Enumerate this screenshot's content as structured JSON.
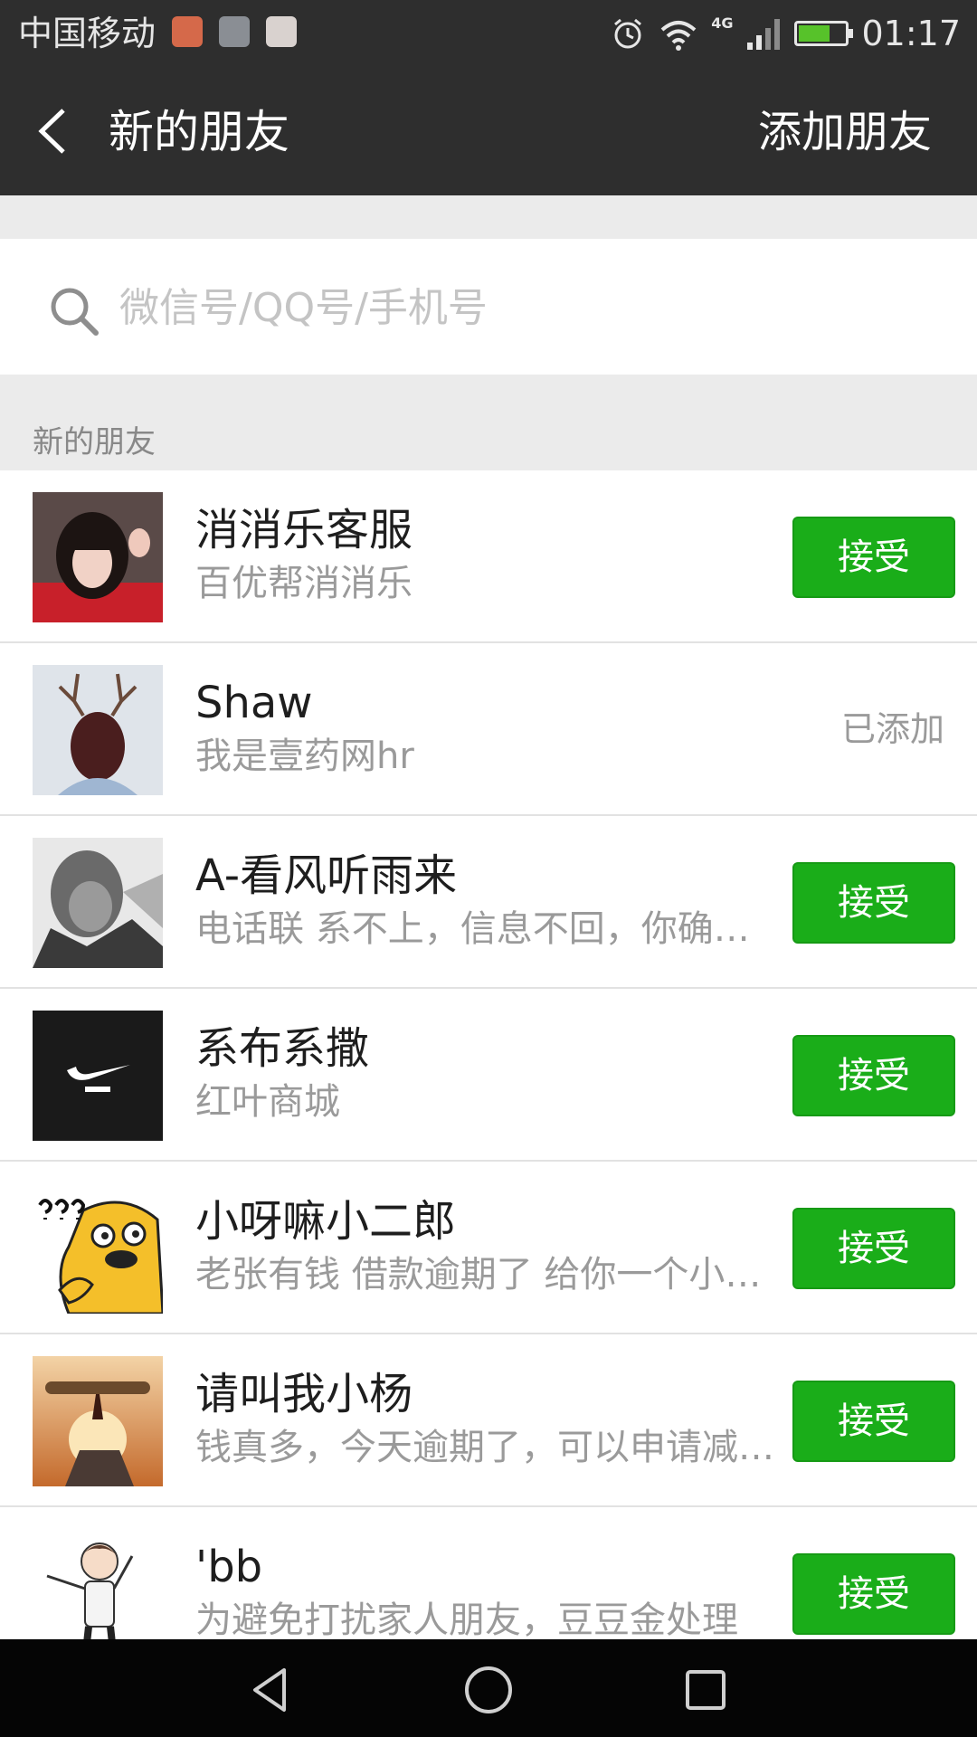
{
  "status_bar": {
    "carrier": "中国移动",
    "network": "4G",
    "time": "01:17",
    "icons_left": [
      "mail-notification-icon",
      "gallery-notification-icon",
      "photo-notification-icon"
    ],
    "icons_right": [
      "alarm-icon",
      "wifi-icon",
      "signal-icon",
      "battery-icon"
    ],
    "battery_level": 0.7,
    "battery_charging": true
  },
  "header": {
    "title": "新的朋友",
    "action_label": "添加朋友"
  },
  "search": {
    "placeholder": "微信号/QQ号/手机号"
  },
  "section": {
    "title": "新的朋友"
  },
  "friends": [
    {
      "name": "消消乐客服",
      "message": "百优帮消消乐",
      "status": "accept",
      "button_label": "接受"
    },
    {
      "name": "Shaw",
      "message": "我是壹药网hr",
      "status": "added",
      "status_text": "已添加"
    },
    {
      "name": "A-看风听雨来",
      "message": "电话联 系不上，信息不回，你确…",
      "status": "accept",
      "button_label": "接受"
    },
    {
      "name": "系布系撒",
      "message": "红叶商城",
      "status": "accept",
      "button_label": "接受"
    },
    {
      "name": "小呀嘛小二郎",
      "message": "老张有钱 借款逾期了 给你一个小…",
      "status": "accept",
      "button_label": "接受"
    },
    {
      "name": "请叫我小杨",
      "message": "钱真多，今天逾期了，可以申请减…",
      "status": "accept",
      "button_label": "接受"
    },
    {
      "name": "'bb",
      "message": "为避免打扰家人朋友，豆豆金处理",
      "status": "accept",
      "button_label": "接受"
    }
  ],
  "colors": {
    "header_bg": "#2e2e2e",
    "accept_green": "#1aad19",
    "page_bg": "#ebebeb"
  },
  "nav_bar": {
    "buttons": [
      "back-triangle-icon",
      "home-circle-icon",
      "recents-square-icon"
    ]
  }
}
